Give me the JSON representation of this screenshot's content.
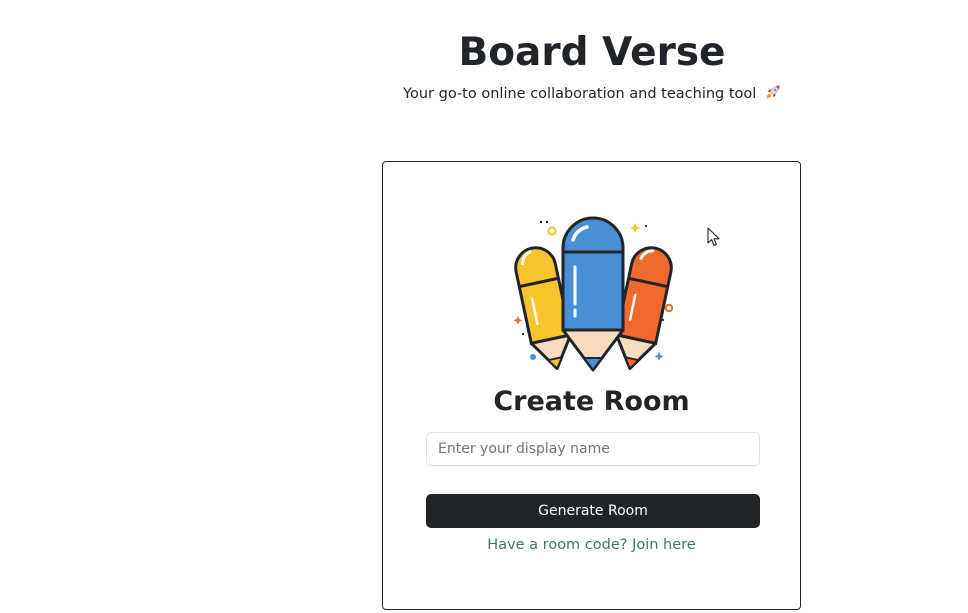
{
  "app": {
    "title": "Board Verse",
    "tagline": "Your go-to online collaboration and teaching tool",
    "tagline_icon": "rocket-icon"
  },
  "card": {
    "illustration": "pencils-icon",
    "title": "Create Room",
    "name_input": {
      "placeholder": "Enter your display name",
      "value": ""
    },
    "generate_button": "Generate Room",
    "join_link": "Have a room code? Join here"
  },
  "colors": {
    "primary_button": "#212529",
    "link": "#3d7a5e",
    "pencil_yellow": "#f7c52b",
    "pencil_blue": "#4a8fd6",
    "pencil_orange": "#ef6a2c"
  }
}
